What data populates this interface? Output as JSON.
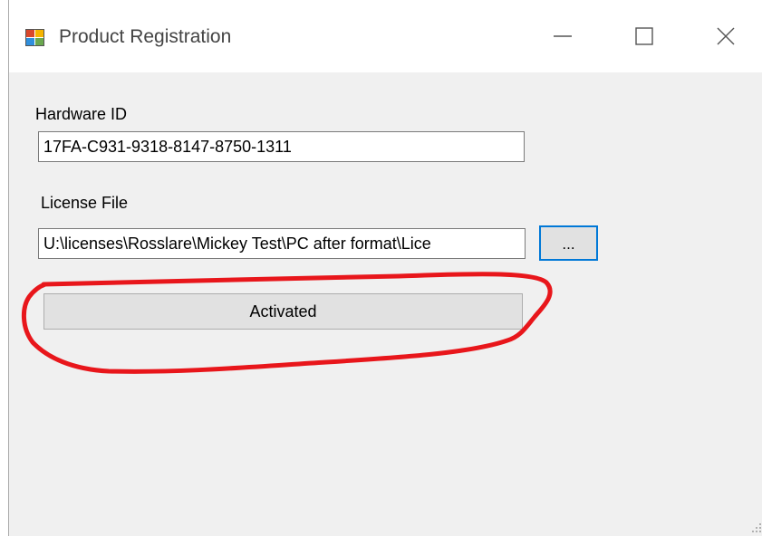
{
  "window": {
    "title": "Product Registration",
    "controls": {
      "minimize_icon": "minimize-icon",
      "maximize_icon": "maximize-icon",
      "close_icon": "close-icon"
    }
  },
  "form": {
    "hardware_id_label": "Hardware ID",
    "hardware_id_value": "17FA-C931-9318-8147-8750-1311",
    "license_file_label": "License File",
    "license_file_value": "U:\\licenses\\Rosslare\\Mickey Test\\PC after format\\Lice",
    "browse_label": "...",
    "activate_label": "Activated"
  },
  "colors": {
    "window_bg": "#f0f0f0",
    "titlebar_bg": "#ffffff",
    "focus_border": "#0078d7",
    "annotation": "#e8161b"
  }
}
